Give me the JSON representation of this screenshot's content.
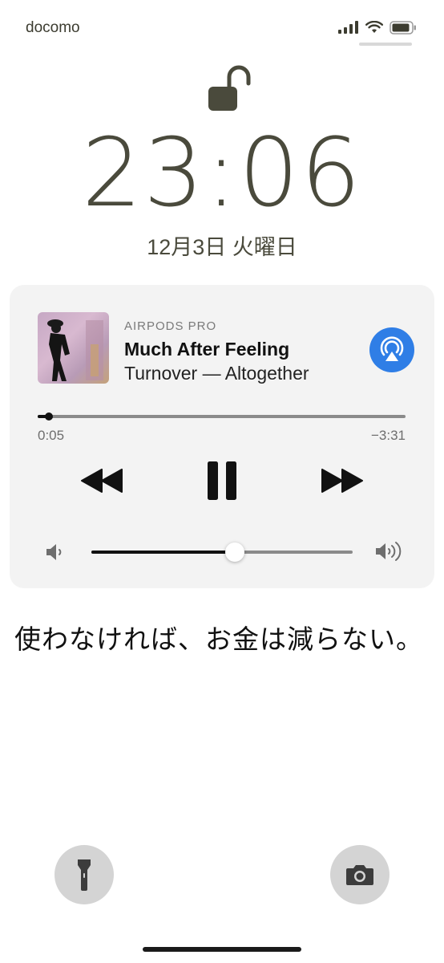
{
  "status_bar": {
    "carrier": "docomo",
    "signal_icon": "cellular-signal-icon",
    "wifi_icon": "wifi-icon",
    "battery_icon": "battery-icon"
  },
  "lock_screen": {
    "lock_icon": "unlocked-padlock-icon",
    "time": "23:06",
    "date": "12月3日 火曜日"
  },
  "now_playing": {
    "device": "AIRPODS PRO",
    "title": "Much After Feeling",
    "artist_album": "Turnover — Altogether",
    "elapsed": "0:05",
    "remaining": "−3:31",
    "progress_fraction": 0.03,
    "volume_fraction": 0.55,
    "controls": {
      "rewind_icon": "rewind-icon",
      "pause_icon": "pause-icon",
      "forward_icon": "fast-forward-icon",
      "airplay_icon": "airplay-audio-icon",
      "volume_low_icon": "speaker-low-icon",
      "volume_high_icon": "speaker-high-icon"
    },
    "accent_color": "#2f7ee6"
  },
  "caption": "使わなければ、お金は減らない。",
  "bottom_actions": {
    "flashlight_icon": "flashlight-icon",
    "camera_icon": "camera-icon"
  }
}
